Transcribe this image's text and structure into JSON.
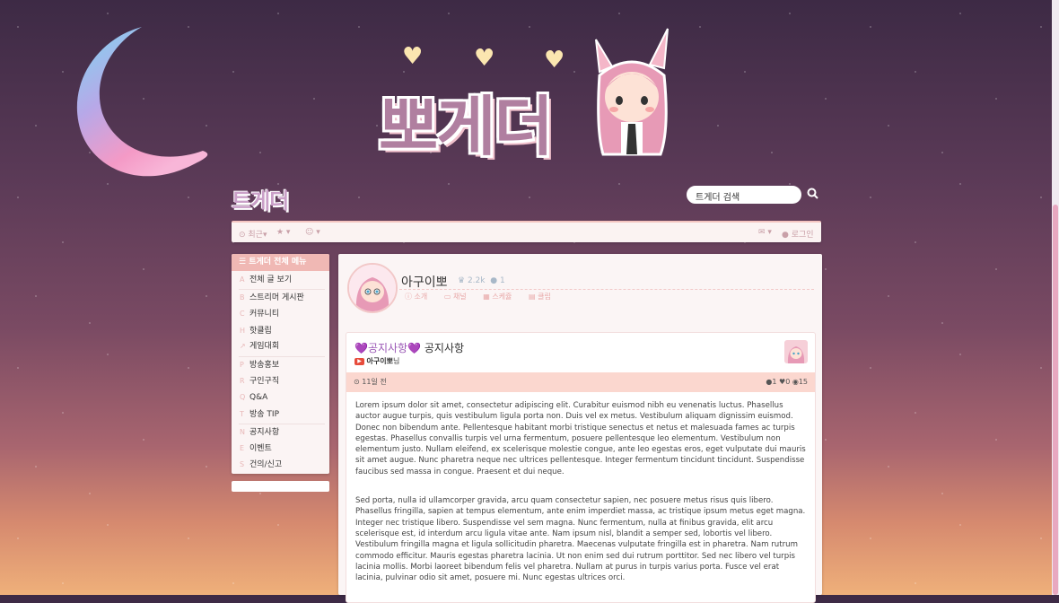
{
  "brand": {
    "logo_text": "뽀게더",
    "small_logo": "트게더"
  },
  "search": {
    "placeholder": "트게더 검색"
  },
  "topbar": {
    "recent_label": "최근",
    "login_label": "로그인"
  },
  "sidebar": {
    "header": "트게더 전체 메뉴",
    "items": [
      {
        "key": "A",
        "label": "전체 글 보기"
      },
      {
        "key": "B",
        "label": "스트리머 게시판"
      },
      {
        "key": "C",
        "label": "커뮤니티"
      },
      {
        "key": "H",
        "label": "핫클립"
      },
      {
        "key": "",
        "label": "게임대회"
      },
      {
        "key": "P",
        "label": "방송홍보"
      },
      {
        "key": "R",
        "label": "구인구직"
      },
      {
        "key": "Q",
        "label": "Q&A"
      },
      {
        "key": "T",
        "label": "방송 TIP"
      },
      {
        "key": "N",
        "label": "공지사항"
      },
      {
        "key": "E",
        "label": "이벤트"
      },
      {
        "key": "S",
        "label": "건의/신고"
      }
    ]
  },
  "channel": {
    "name": "아구이뽀",
    "followers": "2.2k",
    "members": "1",
    "links": [
      "소개",
      "채널",
      "스케쥴",
      "클립"
    ]
  },
  "post": {
    "category": "💜공지사항💜",
    "title": "공지사항",
    "author": "아구이뽀",
    "author_suffix": "님",
    "date": "11일 전",
    "comments": "1",
    "likes": "0",
    "views": "15",
    "paragraphs": [
      "Lorem ipsum dolor sit amet, consectetur adipiscing elit. Curabitur euismod nibh eu venenatis luctus. Phasellus auctor augue turpis, quis vestibulum ligula porta non. Duis vel ex metus. Vestibulum aliquam dignissim euismod. Donec non bibendum ante. Pellentesque habitant morbi tristique senectus et netus et malesuada fames ac turpis egestas. Phasellus convallis turpis vel urna fermentum, posuere pellentesque leo elementum. Vestibulum non elementum justo. Nullam eleifend, ex scelerisque molestie congue, ante leo egestas eros, eget vulputate dui mauris sit amet augue. Nunc pharetra neque nec ultrices pellentesque. Integer fermentum tincidunt tincidunt. Suspendisse faucibus sed massa in congue. Praesent et dui neque.",
      "Sed porta, nulla id ullamcorper gravida, arcu quam consectetur sapien, nec posuere metus risus quis libero. Phasellus fringilla, sapien at tempus elementum, ante enim imperdiet massa, ac tristique ipsum metus eget magna. Integer nec tristique libero. Suspendisse vel sem magna. Nunc fermentum, nulla at finibus gravida, elit arcu scelerisque est, id interdum arcu ligula vitae ante. Nam ipsum nisl, blandit a semper sed, lobortis vel libero. Vestibulum fringilla magna et ligula sollicitudin pharetra. Maecenas vulputate fringilla est in pharetra. Nam rutrum commodo efficitur. Mauris egestas pharetra lacinia. Ut non enim sed dui rutrum porttitor. Sed nec libero vel turpis lacinia mollis. Morbi laoreet bibendum felis vel pharetra. Nullam at purus in turpis varius porta. Fusce vel erat lacinia, pulvinar odio sit amet, posuere mi. Nunc egestas ultrices orci."
    ]
  }
}
